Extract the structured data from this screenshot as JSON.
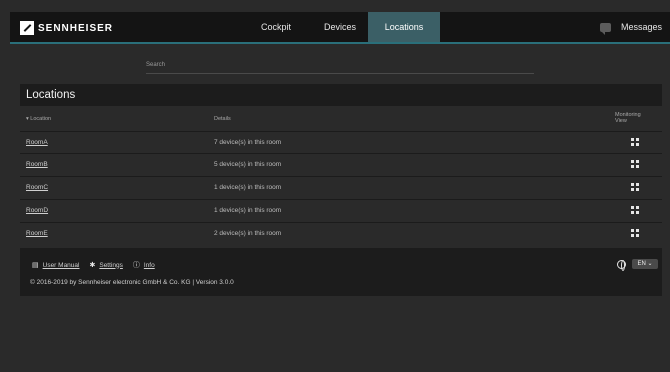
{
  "header": {
    "brand": "SENNHEISER",
    "nav": [
      "Cockpit",
      "Devices",
      "Locations"
    ],
    "messages_label": "Messages"
  },
  "search": {
    "placeholder": "Search"
  },
  "locations": {
    "title": "Locations",
    "columns": {
      "location": "▾ Location",
      "details": "Details",
      "monitoring": "Monitoring View"
    },
    "rows": [
      {
        "name": "RoomA",
        "details": "7 device(s) in this room"
      },
      {
        "name": "RoomB",
        "details": "5 device(s) in this room"
      },
      {
        "name": "RoomC",
        "details": "1 device(s) in this room"
      },
      {
        "name": "RoomD",
        "details": "1 device(s) in this room"
      },
      {
        "name": "RoomE",
        "details": "2 device(s) in this room"
      }
    ]
  },
  "footer": {
    "user_manual": "User Manual",
    "settings": "Settings",
    "info": "Info",
    "copyright": "© 2016-2019 by Sennheiser electronic GmbH & Co. KG | Version 3.0.0",
    "language": "EN ⌄"
  },
  "colors": {
    "accent": "#2a6f7a",
    "active_tab": "#3b5f66",
    "background": "#2a2a2a"
  }
}
